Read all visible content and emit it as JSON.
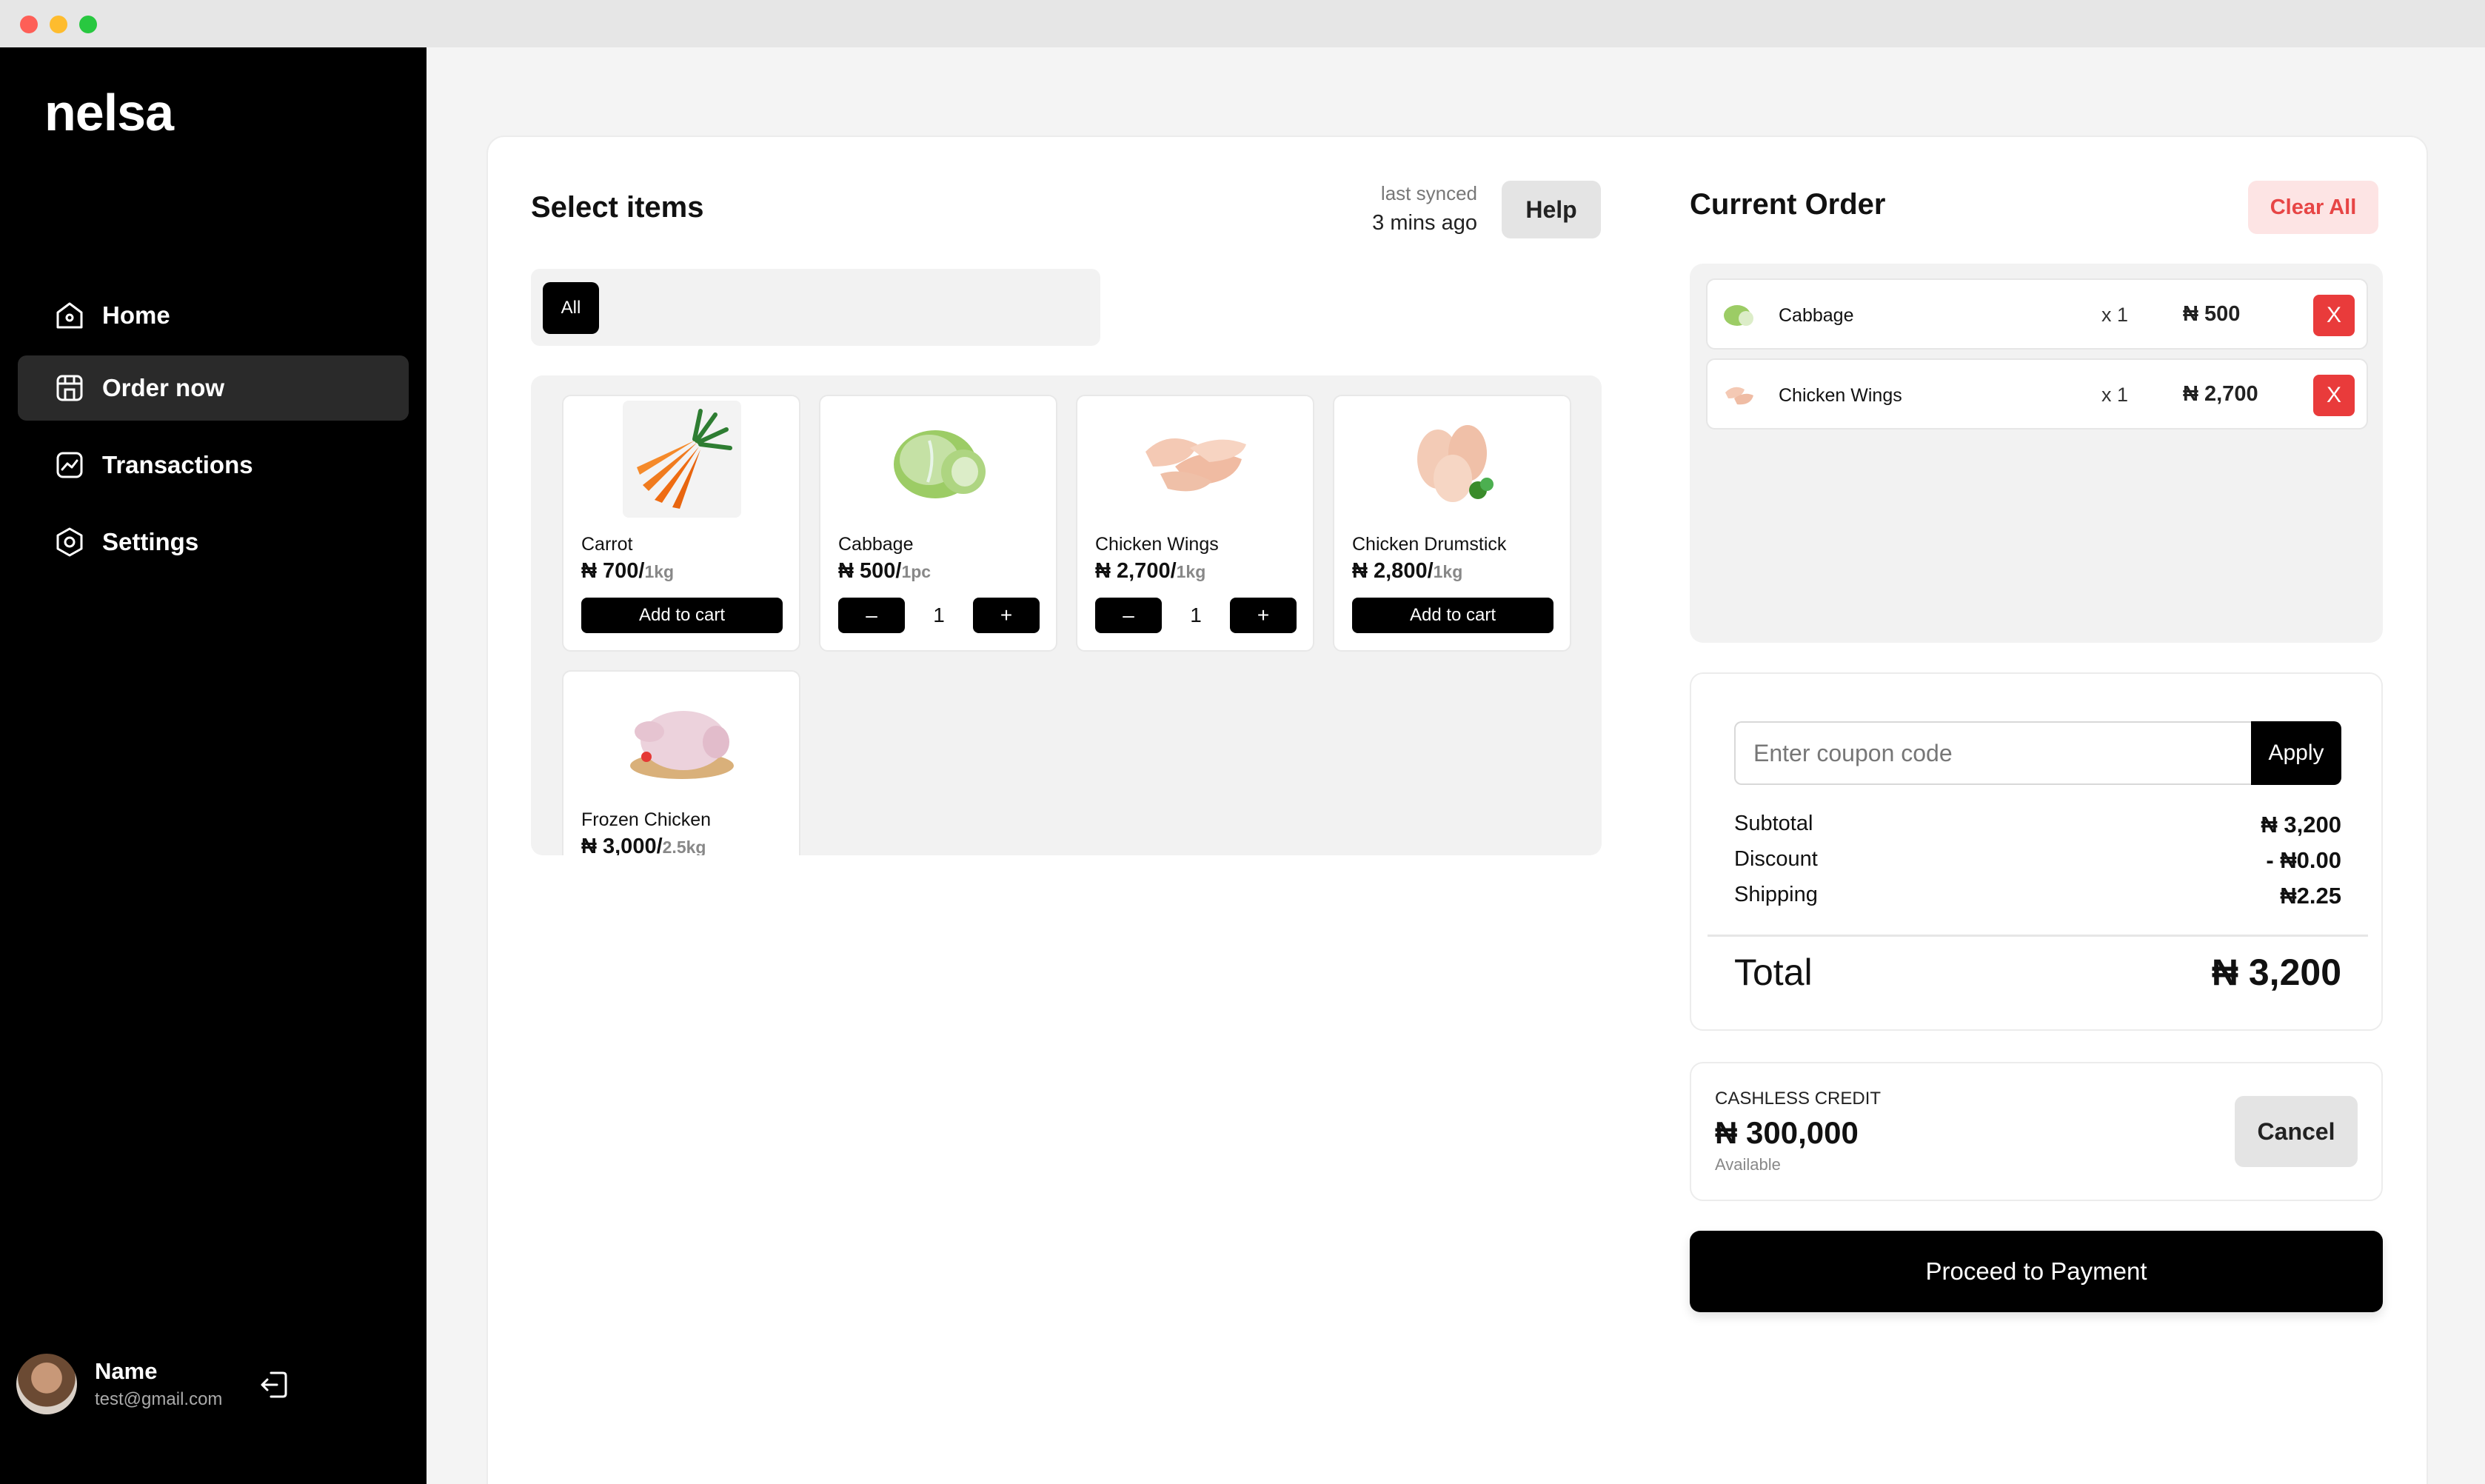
{
  "window": {
    "controls": [
      "close",
      "minimize",
      "maximize"
    ]
  },
  "sidebar": {
    "logo": "nelsa",
    "items": [
      {
        "label": "Home",
        "icon": "home-icon",
        "active": false
      },
      {
        "label": "Order now",
        "icon": "store-icon",
        "active": true
      },
      {
        "label": "Transactions",
        "icon": "chart-icon",
        "active": false
      },
      {
        "label": "Settings",
        "icon": "settings-icon",
        "active": false
      }
    ],
    "user": {
      "name": "Name",
      "email": "test@gmail.com"
    }
  },
  "select": {
    "title": "Select items",
    "synced_label": "last synced",
    "synced_time": "3 mins ago",
    "help": "Help",
    "filter": "All",
    "products": [
      {
        "name": "Carrot",
        "price": "₦ 700/",
        "unit": "1kg",
        "action": "Add to cart"
      },
      {
        "name": "Cabbage",
        "price": "₦ 500/",
        "unit": "1pc",
        "qty": "1",
        "minus": "–",
        "plus": "+"
      },
      {
        "name": "Chicken Wings",
        "price": "₦ 2,700/",
        "unit": "1kg",
        "qty": "1",
        "minus": "–",
        "plus": "+"
      },
      {
        "name": "Chicken Drumstick",
        "price": "₦ 2,800/",
        "unit": "1kg",
        "action": "Add to cart"
      },
      {
        "name": "Frozen Chicken",
        "price": "₦ 3,000/",
        "unit": "2.5kg"
      }
    ]
  },
  "order": {
    "title": "Current Order",
    "clear": "Clear All",
    "items": [
      {
        "name": "Cabbage",
        "qty": "x 1",
        "price": "₦ 500",
        "remove": "X"
      },
      {
        "name": "Chicken Wings",
        "qty": "x 1",
        "price": "₦ 2,700",
        "remove": "X"
      }
    ],
    "coupon_placeholder": "Enter coupon code",
    "apply": "Apply",
    "subtotal_label": "Subtotal",
    "subtotal": "₦ 3,200",
    "discount_label": "Discount",
    "discount": "- ₦0.00",
    "shipping_label": "Shipping",
    "shipping": "₦2.25",
    "total_label": "Total",
    "total": "₦ 3,200"
  },
  "credit": {
    "label": "CASHLESS CREDIT",
    "amount": "₦ 300,000",
    "available": "Available",
    "cancel": "Cancel"
  },
  "payment": {
    "label": "Proceed to Payment"
  },
  "colors": {
    "accent": "#000000",
    "danger": "#e93b3b",
    "danger_soft": "#fde4e4"
  }
}
